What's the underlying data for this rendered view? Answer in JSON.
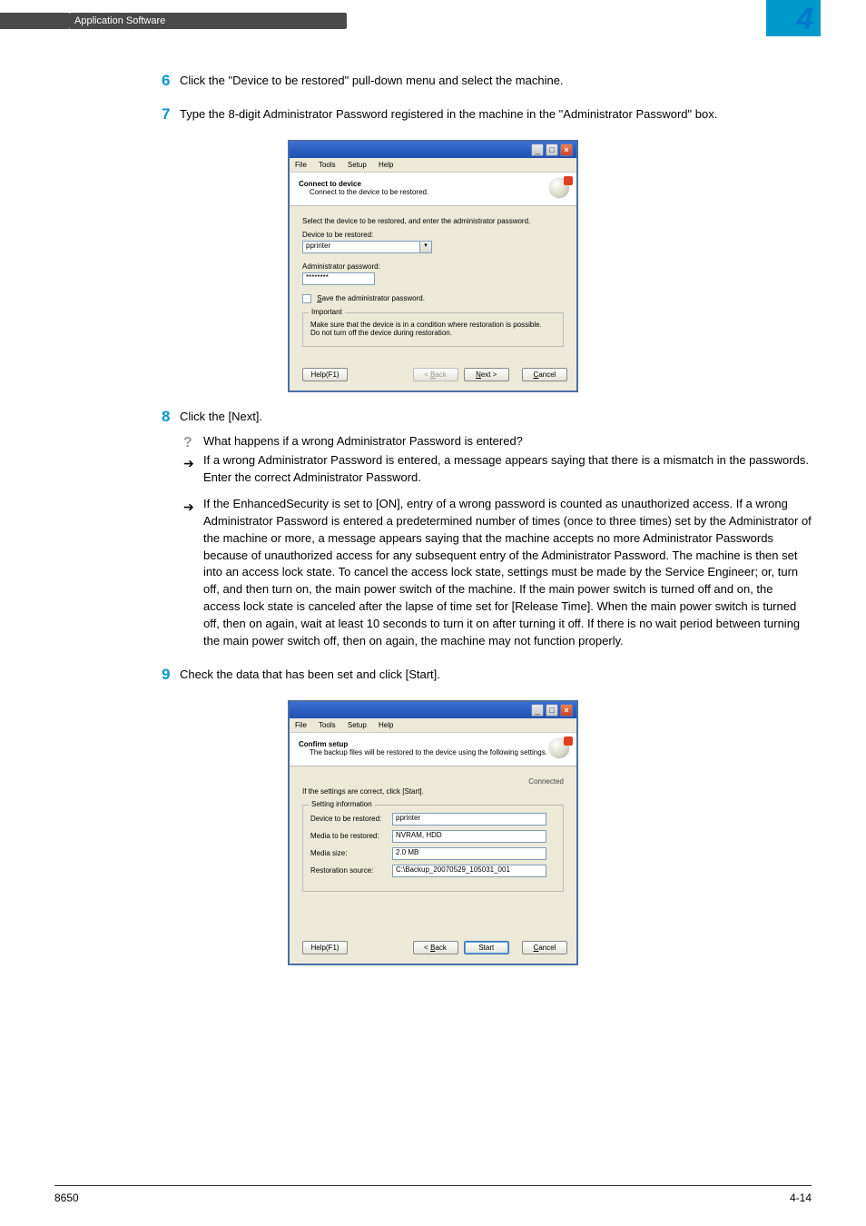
{
  "header": {
    "section_title": "Application Software",
    "chapter_number": "4"
  },
  "steps": {
    "s6": {
      "num": "6",
      "text": "Click the \"Device to be restored\" pull-down menu and select the machine."
    },
    "s7": {
      "num": "7",
      "text": "Type the 8-digit Administrator Password registered in the machine in the \"Administrator Password\" box."
    },
    "s8": {
      "num": "8",
      "text": "Click the [Next].",
      "q": "What happens if a wrong Administrator Password is entered?",
      "a1": "If a wrong Administrator Password is entered, a message appears saying that there is a mismatch in the passwords. Enter the correct Administrator Password.",
      "a2": "If the EnhancedSecurity is set to [ON], entry of a wrong password is counted as unauthorized access. If a wrong Administrator Password is entered a predetermined number of times (once to three times) set by the Administrator of the machine or more, a message appears saying that the machine accepts no more Administrator Passwords because of unauthorized access for any subsequent entry of the Administrator Password. The machine is then set into an access lock state. To cancel the access lock state, settings must be made by the Service Engineer; or, turn off, and then turn on, the main power switch of the machine. If the main power switch is turned off and on, the access lock state is canceled after the lapse of time set for [Release Time]. When the main power switch is turned off, then on again, wait at least 10 seconds to turn it on after turning it off. If there is no wait period between turning the main power switch off, then on again, the machine may not function properly."
    },
    "s9": {
      "num": "9",
      "text": "Check the data that has been set and click [Start]."
    }
  },
  "dialog1": {
    "menus": {
      "file": "File",
      "tools": "Tools",
      "setup": "Setup",
      "help": "Help"
    },
    "title": "Connect to device",
    "subtitle": "Connect to the device to be restored.",
    "instruction": "Select the device to be restored, and enter the administrator password.",
    "device_label_char": "D",
    "device_label_rest": "evice to be restored:",
    "device_value": "pprinter",
    "admin_label": "Administrator password:",
    "admin_value": "********",
    "save_chk_char": "S",
    "save_chk_rest": "ave the administrator password.",
    "important_title": "Important",
    "important1": "Make sure that the device is in a condition where restoration is possible.",
    "important2": "Do not turn off the device during restoration.",
    "help_btn": "Help(F1)",
    "back_btn_char": "B",
    "back_btn": "ack",
    "next_btn_char": "N",
    "next_btn": "ext >",
    "cancel_btn_char": "C",
    "cancel_btn": "ancel"
  },
  "dialog2": {
    "title": "Confirm setup",
    "subtitle": "The backup files will be restored to the device using the following settings.",
    "connected": "Connected",
    "instruction": "If the settings are correct, click [Start].",
    "group_title": "Setting information",
    "device_label": "Device to be restored:",
    "device_value": "pprinter",
    "media_label": "Media to be restored:",
    "media_value": "NVRAM, HDD",
    "size_label": "Media size:",
    "size_value": "2.0 MB",
    "source_label": "Restoration source:",
    "source_value": "C:\\Backup_20070529_105031_001",
    "help_btn": "Help(F1)",
    "back_btn_char": "B",
    "back_btn": "ack",
    "start_btn": "Start",
    "cancel_btn_char": "C",
    "cancel_btn": "ancel"
  },
  "footer": {
    "left": "8650",
    "right": "4-14"
  }
}
